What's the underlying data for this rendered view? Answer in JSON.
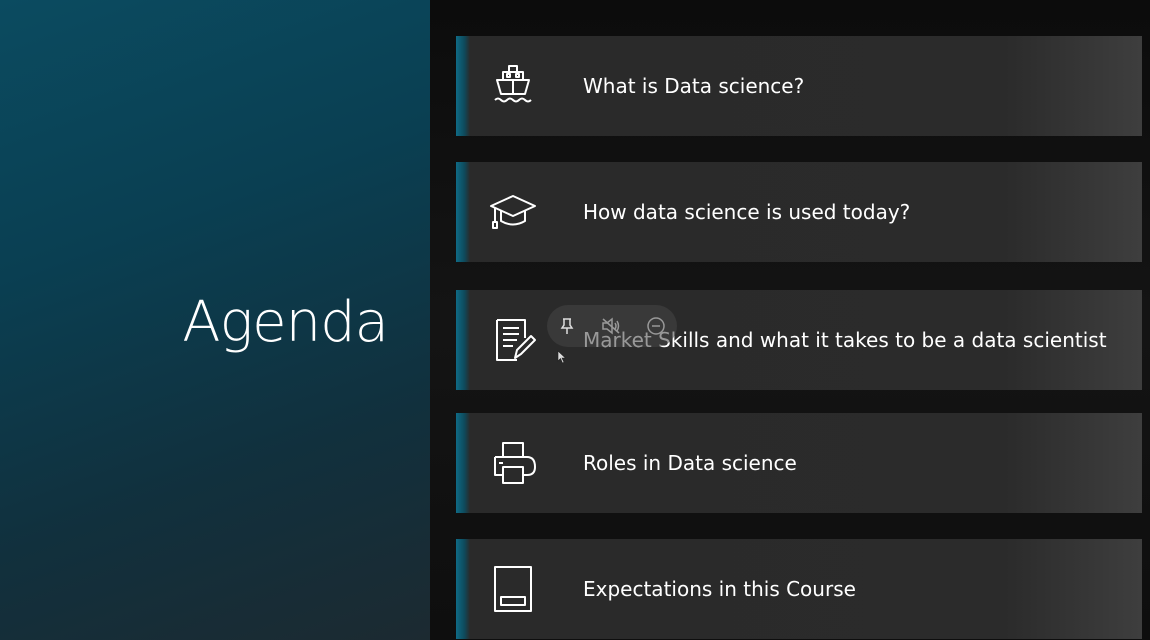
{
  "slide": {
    "title": "Agenda",
    "items": [
      {
        "label": "What is Data science?",
        "icon": "ship-icon"
      },
      {
        "label": "How data science is used today?",
        "icon": "graduation-cap-icon"
      },
      {
        "label": "Market Skills and what it takes to be a data scientist",
        "icon": "checklist-pen-icon"
      },
      {
        "label": "Roles in Data science",
        "icon": "printer-icon"
      },
      {
        "label": "Expectations in this Course",
        "icon": "panel-icon"
      }
    ]
  },
  "overlay_controls": [
    "pin-icon",
    "mute-icon",
    "zoom-out-icon"
  ],
  "colors": {
    "accent": "#0f6b86",
    "left_panel": "#0b4b60",
    "item_bg": "#2a2a2a",
    "text": "#ffffff"
  }
}
